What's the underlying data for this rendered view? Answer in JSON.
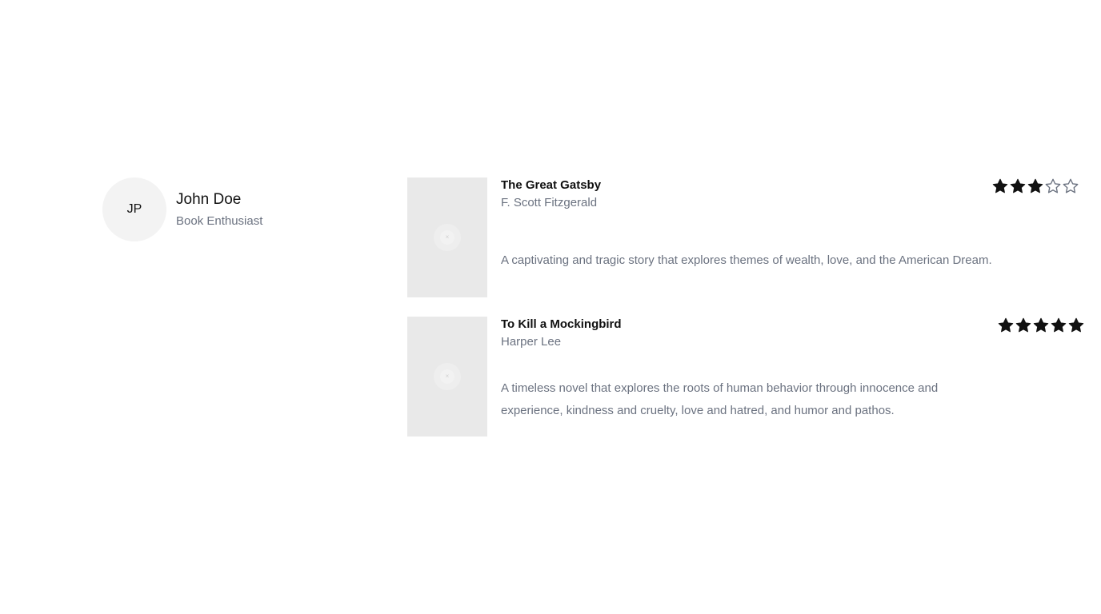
{
  "profile": {
    "initials": "JP",
    "name": "John Doe",
    "role": "Book Enthusiast"
  },
  "reviews": [
    {
      "title": "The Great Gatsby",
      "author": "F. Scott Fitzgerald",
      "text": "A captivating and tragic story that explores themes of wealth, love, and the American Dream.",
      "rating": 3,
      "max_rating": 5,
      "cover_icon": "image-placeholder-icon"
    },
    {
      "title": "To Kill a Mockingbird",
      "author": "Harper Lee",
      "text": "A timeless novel that explores the roots of human behavior through innocence and experience, kindness and cruelty, love and hatred, and humor and pathos.",
      "rating": 5,
      "max_rating": 5,
      "cover_icon": "image-placeholder-icon"
    }
  ],
  "colors": {
    "star_filled": "#111111",
    "star_empty": "#6b7280"
  }
}
